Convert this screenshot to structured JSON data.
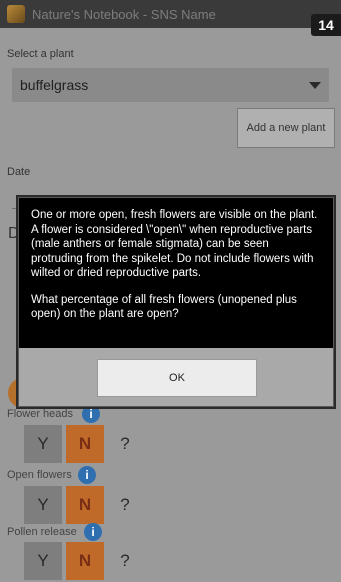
{
  "titlebar": {
    "title": "Nature's Notebook - SNS Name",
    "badge": "14"
  },
  "form": {
    "select_plant_label": "Select a plant",
    "plant_value": "buffelgrass",
    "add_plant_button": "Add a new plant",
    "date_label": "Date",
    "date_fragment": "D"
  },
  "phenophases": [
    {
      "label": "Flower heads",
      "y": "Y",
      "n": "N",
      "q": "?"
    },
    {
      "label": "Open flowers",
      "y": "Y",
      "n": "N",
      "q": "?"
    },
    {
      "label": "Pollen release",
      "y": "Y",
      "n": "N",
      "q": "?"
    }
  ],
  "dialog": {
    "paragraph1": "One or more open, fresh flowers are visible on the plant. A flower is considered \\\"open\\\" when reproductive parts (male anthers or female stigmata) can be seen protruding from the spikelet. Do not include flowers with wilted or dried reproductive parts.",
    "paragraph2": "What percentage of all fresh flowers (unopened plus open) on the plant are open?",
    "ok_label": "OK"
  },
  "colors": {
    "accent_orange": "#c06a2a",
    "info_blue": "#2f6fb0",
    "dialog_bg": "#000000"
  }
}
